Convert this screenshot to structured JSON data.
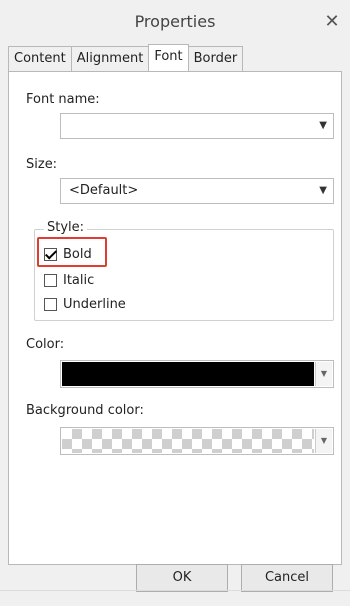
{
  "window": {
    "title": "Properties",
    "close_glyph": "✕",
    "close_icon": "close-icon"
  },
  "tabs": [
    {
      "label": "Content",
      "active": false
    },
    {
      "label": "Alignment",
      "active": false
    },
    {
      "label": "Font",
      "active": true
    },
    {
      "label": "Border",
      "active": false
    }
  ],
  "font": {
    "name_label": "Font name:",
    "name_value": "",
    "size_label": "Size:",
    "size_value": "<Default>",
    "style_label": "Style:",
    "styles": [
      {
        "label": "Bold",
        "checked": true,
        "highlighted": true
      },
      {
        "label": "Italic",
        "checked": false
      },
      {
        "label": "Underline",
        "checked": false
      }
    ],
    "color_label": "Color:",
    "color_value": "#000000",
    "bg_label": "Background color:",
    "bg_value": "transparent"
  },
  "buttons": {
    "ok": "OK",
    "cancel": "Cancel"
  },
  "colors": {
    "highlight": "#e03c31",
    "panel_bg": "#ffffff",
    "window_bg": "#f0f0f0"
  }
}
